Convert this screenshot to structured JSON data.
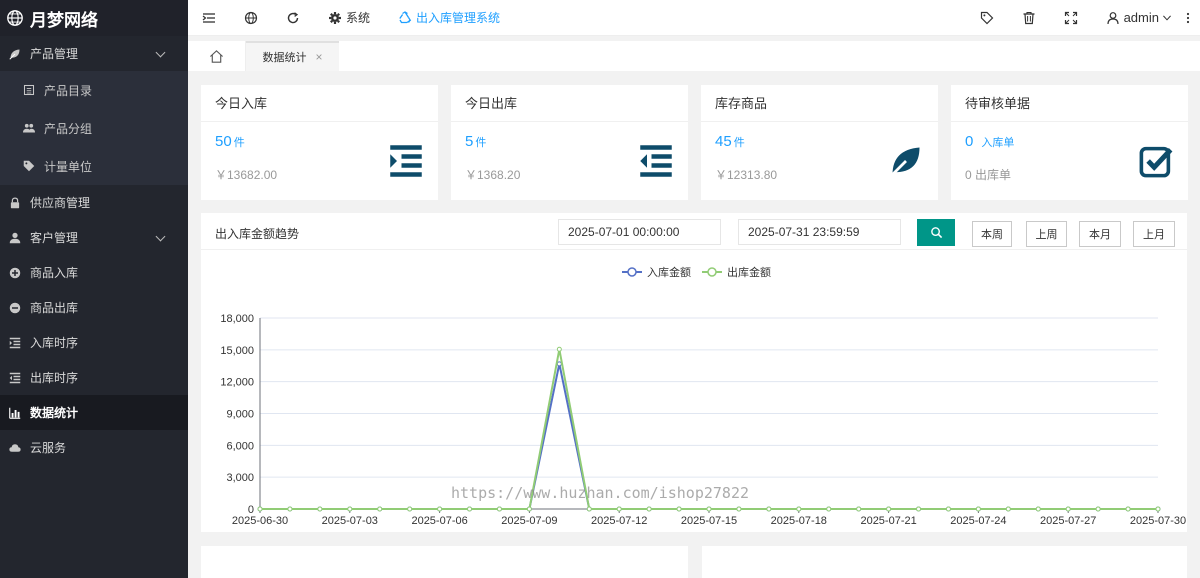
{
  "brand": {
    "name": "月梦网络"
  },
  "sidebar": {
    "items": [
      {
        "key": "product-mgmt",
        "label": "产品管理",
        "icon": "leaf-icon",
        "expandable": true
      },
      {
        "key": "product-catalog",
        "label": "产品目录",
        "icon": "list-icon",
        "sub": true
      },
      {
        "key": "product-group",
        "label": "产品分组",
        "icon": "users-icon",
        "sub": true
      },
      {
        "key": "unit",
        "label": "计量单位",
        "icon": "tag-icon",
        "sub": true
      },
      {
        "key": "supplier-mgmt",
        "label": "供应商管理",
        "icon": "lock-icon"
      },
      {
        "key": "customer-mgmt",
        "label": "客户管理",
        "icon": "user-icon",
        "expandable": true
      },
      {
        "key": "stock-in",
        "label": "商品入库",
        "icon": "plus-circle-icon"
      },
      {
        "key": "stock-out",
        "label": "商品出库",
        "icon": "minus-circle-icon"
      },
      {
        "key": "in-order",
        "label": "入库时序",
        "icon": "indent-icon"
      },
      {
        "key": "out-order",
        "label": "出库时序",
        "icon": "outdent-icon"
      },
      {
        "key": "statistics",
        "label": "数据统计",
        "icon": "bar-chart-icon",
        "active": true
      },
      {
        "key": "cloud",
        "label": "云服务",
        "icon": "cloud-icon"
      }
    ]
  },
  "header": {
    "system_label": "系统",
    "app_title": "出入库管理系统",
    "user": "admin"
  },
  "tabs": [
    {
      "label": "数据统计",
      "close": "×"
    }
  ],
  "cards": [
    {
      "title": "今日入库",
      "value": "50",
      "unit": "件",
      "sub": "￥13682.00",
      "icon": "indent-icon"
    },
    {
      "title": "今日出库",
      "value": "5",
      "unit": "件",
      "sub": "￥1368.20",
      "icon": "outdent-icon"
    },
    {
      "title": "库存商品",
      "value": "45",
      "unit": "件",
      "sub": "￥12313.80",
      "icon": "leaf-icon"
    },
    {
      "title": "待审核单据",
      "value": "0",
      "unit": "入库单",
      "sub": "0 出库单",
      "icon": "checkbox-icon"
    }
  ],
  "trend": {
    "title": "出入库金额趋势",
    "start": "2025-07-01 00:00:00",
    "end": "2025-07-31 23:59:59",
    "ranges": [
      "本周",
      "上周",
      "本月",
      "上月"
    ]
  },
  "watermark": "https://www.huzhan.com/ishop27822",
  "colors": {
    "in_series": "#5470c6",
    "out_series": "#91cc75",
    "accent": "#009688",
    "link": "#1e9fff"
  },
  "chart_data": {
    "type": "line",
    "x": [
      "2025-06-30",
      "2025-07-01",
      "2025-07-02",
      "2025-07-03",
      "2025-07-04",
      "2025-07-05",
      "2025-07-06",
      "2025-07-07",
      "2025-07-08",
      "2025-07-09",
      "2025-07-10",
      "2025-07-11",
      "2025-07-12",
      "2025-07-13",
      "2025-07-14",
      "2025-07-15",
      "2025-07-16",
      "2025-07-17",
      "2025-07-18",
      "2025-07-19",
      "2025-07-20",
      "2025-07-21",
      "2025-07-22",
      "2025-07-23",
      "2025-07-24",
      "2025-07-25",
      "2025-07-26",
      "2025-07-27",
      "2025-07-28",
      "2025-07-29",
      "2025-07-30"
    ],
    "xticks": [
      "2025-06-30",
      "2025-07-03",
      "2025-07-06",
      "2025-07-09",
      "2025-07-12",
      "2025-07-15",
      "2025-07-18",
      "2025-07-21",
      "2025-07-24",
      "2025-07-27",
      "2025-07-30"
    ],
    "yticks": [
      "0",
      "3,000",
      "6,000",
      "9,000",
      "12,000",
      "15,000",
      "18,000"
    ],
    "ylim": [
      0,
      18000
    ],
    "series": [
      {
        "name": "入库金额",
        "values": [
          0,
          0,
          0,
          0,
          0,
          0,
          0,
          0,
          0,
          0,
          13682,
          0,
          0,
          0,
          0,
          0,
          0,
          0,
          0,
          0,
          0,
          0,
          0,
          0,
          0,
          0,
          0,
          0,
          0,
          0,
          0
        ]
      },
      {
        "name": "出库金额",
        "values": [
          0,
          0,
          0,
          0,
          0,
          0,
          0,
          0,
          0,
          0,
          15050,
          0,
          0,
          0,
          0,
          0,
          0,
          0,
          0,
          0,
          0,
          0,
          0,
          0,
          0,
          0,
          0,
          0,
          0,
          0,
          0
        ]
      }
    ],
    "legend": "top-center",
    "grid": true
  }
}
